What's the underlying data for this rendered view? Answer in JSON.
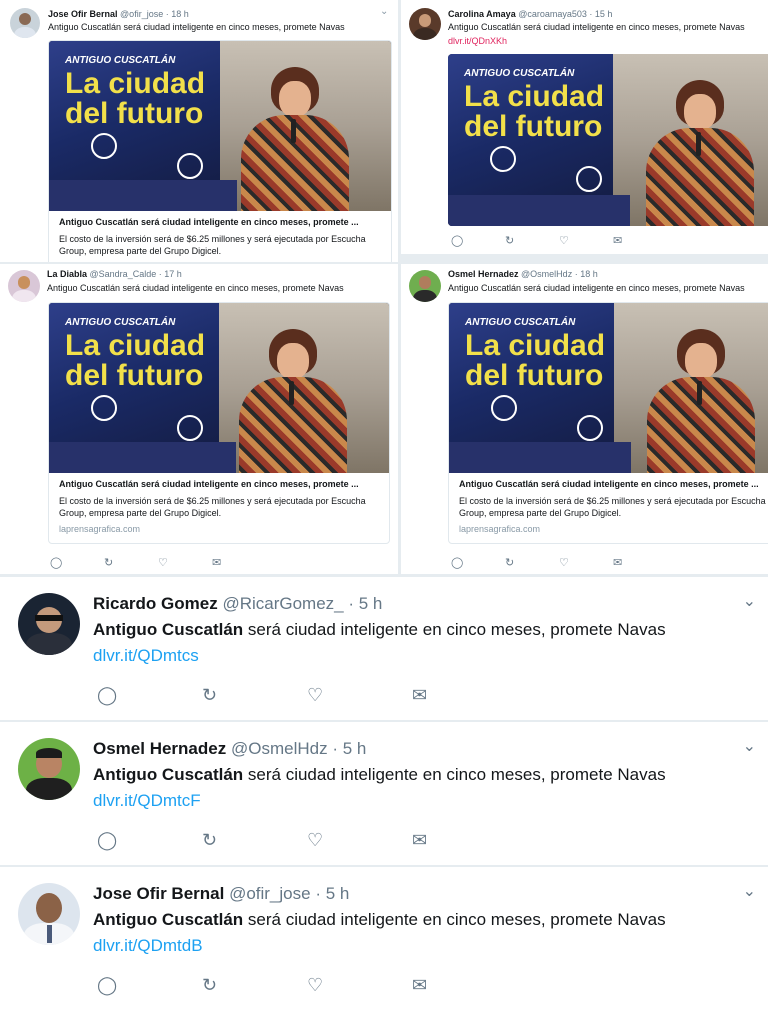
{
  "card": {
    "brand": "ANTIGUO CUSCATLÁN",
    "headline_1": "La ciudad",
    "headline_2": "del futuro",
    "title": "Antiguo Cuscatlán será ciudad inteligente en cinco meses, promete ...",
    "title_alt": "Antiguo Cuscatlán será ciudad inteligente en cinco meses, promete ...",
    "desc": "El costo de la inversión será de $6.25 millones y será ejecutada por Escucha Group, empresa parte del Grupo Digicel.",
    "domain": "laprensagrafica.com"
  },
  "tweet_text": "Antiguo Cuscatlán será ciudad inteligente en cinco meses, promete Navas",
  "small_tweets": [
    {
      "name": "Jose Ofir Bernal",
      "handle": "@ofir_jose",
      "time": "· 18 h"
    },
    {
      "name": "Carolina Amaya",
      "handle": "@caroamaya503",
      "time": "· 15 h",
      "link": "dlvr.it/QDnXKh"
    },
    {
      "name": "La Diabla",
      "handle": "@Sandra_Calde",
      "time": "· 17 h"
    },
    {
      "name": "Osmel Hernadez",
      "handle": "@OsmelHdz",
      "time": "· 18 h"
    }
  ],
  "big_tweets": [
    {
      "name": "Ricardo Gomez",
      "handle": "@RicarGomez_",
      "time": "· 5 h",
      "bold": "Antiguo Cuscatlán",
      "rest": " será ciudad inteligente en cinco meses, promete Navas",
      "link": "dlvr.it/QDmtcs"
    },
    {
      "name": "Osmel Hernadez",
      "handle": "@OsmelHdz",
      "time": "· 5 h",
      "bold": "Antiguo Cuscatlán",
      "rest": " será ciudad inteligente en cinco meses, promete Navas",
      "link": "dlvr.it/QDmtcF"
    },
    {
      "name": "Jose Ofir Bernal",
      "handle": "@ofir_jose",
      "time": "· 5 h",
      "bold": "Antiguo Cuscatlán",
      "rest": " será ciudad inteligente en cinco meses, promete Navas",
      "link": "dlvr.it/QDmtdB"
    }
  ],
  "icons": {
    "reply": "reply-icon",
    "retweet": "retweet-icon",
    "like": "heart-icon",
    "dm": "envelope-icon",
    "more": "chevron-down-icon"
  },
  "colors": {
    "link": "#1da1f2",
    "short_link": "#e0245e",
    "muted": "#657786"
  }
}
